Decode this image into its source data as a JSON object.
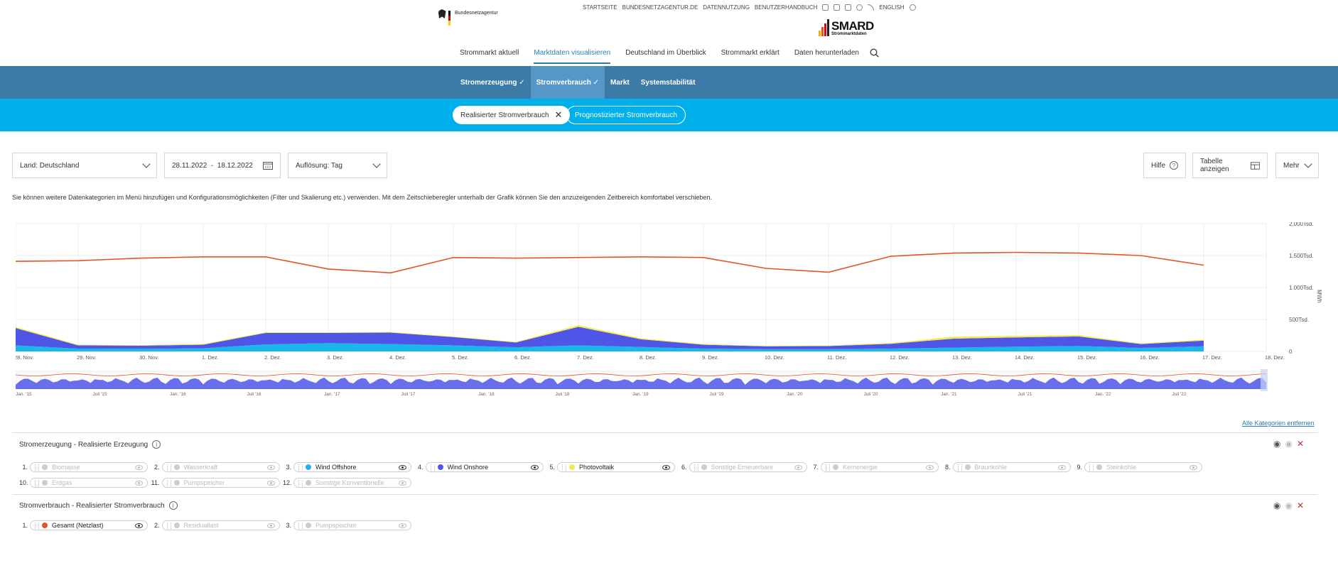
{
  "header": {
    "org_name": "Bundesnetzagentur",
    "brand": {
      "title": "SMARD",
      "subtitle": "Strommarktdaten"
    },
    "top_links": [
      "STARTSEITE",
      "BUNDESNETZAGENTUR.DE",
      "DATENNUTZUNG",
      "BENUTZERHANDBUCH"
    ],
    "language_label": "ENGLISH",
    "main_nav": [
      "Strommarkt aktuell",
      "Marktdaten visualisieren",
      "Deutschland im Überblick",
      "Strommarkt erklärt",
      "Daten herunterladen"
    ],
    "main_nav_active": "Marktdaten visualisieren",
    "icons": [
      "accessibility-icon",
      "sign-language-icon",
      "easy-language-icon",
      "link-icon",
      "rss-icon",
      "globe-icon",
      "search-icon"
    ]
  },
  "subnav": {
    "items": [
      "Stromerzeugung",
      "Stromverbrauch",
      "Markt",
      "Systemstabilität"
    ],
    "active": "Stromverbrauch"
  },
  "chips": {
    "active": "Realisierter Stromverbrauch",
    "inactive": "Prognostizierter Stromverbrauch"
  },
  "controls": {
    "land": "Land: Deutschland",
    "date_from": "28.11.2022",
    "date_sep": "-",
    "date_to": "18.12.2022",
    "resolution": "Auflösung: Tag",
    "help": "Hilfe",
    "table": "Tabelle anzeigen",
    "more": "Mehr"
  },
  "info_text": "Sie können weitere Datenkategorien im Menü hinzufügen und Konfigurationsmöglichkeiten (Filter und Skalierung etc.) verwenden. Mit dem Zeitschieberegler unterhalb der Grafik können Sie den anzuzeigenden Zeitbereich komfortabel verschieben.",
  "chart_data": {
    "type": "area",
    "ylabel": "MWh",
    "ylim": [
      0,
      2000000
    ],
    "ytick_labels": [
      "0",
      "500Tsd.",
      "1.000Tsd.",
      "1.500Tsd.",
      "2.000Tsd."
    ],
    "x": [
      "28. Nov.",
      "29. Nov.",
      "30. Nov.",
      "1. Dez.",
      "2. Dez.",
      "3. Dez.",
      "4. Dez.",
      "5. Dez.",
      "6. Dez.",
      "7. Dez.",
      "8. Dez.",
      "9. Dez.",
      "10. Dez.",
      "11. Dez.",
      "12. Dez.",
      "13. Dez.",
      "14. Dez.",
      "15. Dez.",
      "16. Dez.",
      "17. Dez.",
      "18. Dez."
    ],
    "series": [
      {
        "name": "Wind Offshore",
        "color": "#1ab7ea",
        "values": [
          95000,
          45000,
          40000,
          50000,
          110000,
          130000,
          115000,
          95000,
          65000,
          95000,
          70000,
          45000,
          35000,
          35000,
          45000,
          60000,
          75000,
          85000,
          55000,
          80000,
          null
        ]
      },
      {
        "name": "Wind Onshore",
        "color": "#4f55e6",
        "values": [
          270000,
          50000,
          50000,
          55000,
          180000,
          160000,
          180000,
          130000,
          75000,
          290000,
          120000,
          60000,
          45000,
          50000,
          75000,
          140000,
          145000,
          150000,
          60000,
          90000,
          null
        ]
      },
      {
        "name": "Photovoltaik",
        "color": "#f5e94f",
        "values": [
          20000,
          10000,
          10000,
          12000,
          10000,
          9000,
          9000,
          9000,
          10000,
          25000,
          15000,
          10000,
          8000,
          8000,
          12000,
          30000,
          25000,
          20000,
          12000,
          15000,
          null
        ]
      },
      {
        "name": "Gesamt (Netzlast)",
        "color": "#e1542a",
        "values": [
          1410000,
          1420000,
          1460000,
          1480000,
          1480000,
          1290000,
          1230000,
          1470000,
          1460000,
          1470000,
          1480000,
          1470000,
          1300000,
          1240000,
          1490000,
          1540000,
          1550000,
          1540000,
          1500000,
          1350000,
          null
        ]
      }
    ],
    "navigator_labels": [
      "Jan. '15",
      "Juli '15",
      "Jan. '16",
      "Juli '16",
      "Jan. '17",
      "Juli '17",
      "Jan. '18",
      "Juli '18",
      "Jan. '19",
      "Juli '19",
      "Jan. '20",
      "Juli '20",
      "Jan. '21",
      "Juli '21",
      "Jan. '22",
      "Juli '22"
    ]
  },
  "remove_all": "Alle Kategorien entfernen",
  "sections": [
    {
      "title": "Stromerzeugung - Realisierte Erzeugung",
      "items": [
        {
          "n": "1.",
          "label": "Biomasse",
          "on": false,
          "color": "#cccccc"
        },
        {
          "n": "2.",
          "label": "Wasserkraft",
          "on": false,
          "color": "#cccccc"
        },
        {
          "n": "3.",
          "label": "Wind Offshore",
          "on": true,
          "color": "#1ab7ea"
        },
        {
          "n": "4.",
          "label": "Wind Onshore",
          "on": true,
          "color": "#4f55e6"
        },
        {
          "n": "5.",
          "label": "Photovoltaik",
          "on": true,
          "color": "#f5e94f"
        },
        {
          "n": "6.",
          "label": "Sonstige Erneuerbare",
          "on": false,
          "color": "#cccccc"
        },
        {
          "n": "7.",
          "label": "Kernenergie",
          "on": false,
          "color": "#cccccc"
        },
        {
          "n": "8.",
          "label": "Braunkohle",
          "on": false,
          "color": "#cccccc"
        },
        {
          "n": "9.",
          "label": "Steinkohle",
          "on": false,
          "color": "#cccccc"
        },
        {
          "n": "10.",
          "label": "Erdgas",
          "on": false,
          "color": "#cccccc"
        },
        {
          "n": "11.",
          "label": "Pumpspeicher",
          "on": false,
          "color": "#cccccc"
        },
        {
          "n": "12.",
          "label": "Sonstige Konventionelle",
          "on": false,
          "color": "#cccccc"
        }
      ]
    },
    {
      "title": "Stromverbrauch - Realisierter Stromverbrauch",
      "items": [
        {
          "n": "1.",
          "label": "Gesamt (Netzlast)",
          "on": true,
          "color": "#e1542a"
        },
        {
          "n": "2.",
          "label": "Residuallast",
          "on": false,
          "color": "#cccccc"
        },
        {
          "n": "3.",
          "label": "Pumpspeicher",
          "on": false,
          "color": "#cccccc"
        }
      ]
    }
  ]
}
